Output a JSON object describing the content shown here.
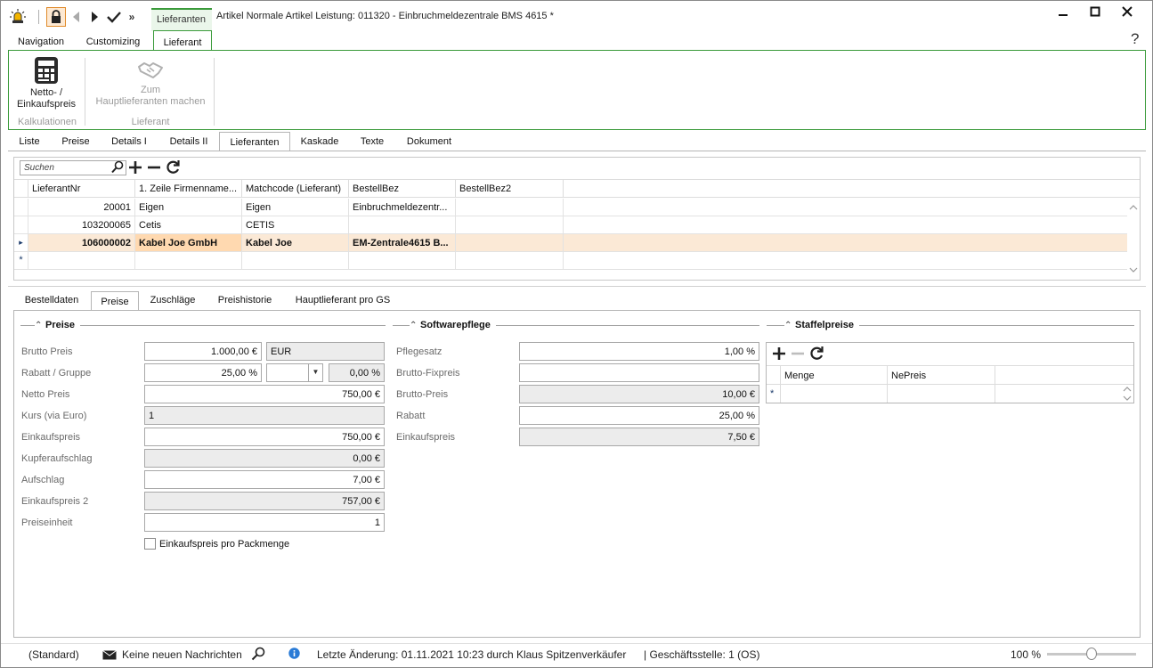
{
  "window": {
    "title": "Artikel Normale Artikel Leistung: 011320 - Einbruchmeldezentrale BMS 4615 *",
    "context_tab": "Lieferanten"
  },
  "ribbon_tabs": [
    "Navigation",
    "Customizing",
    "Lieferant"
  ],
  "ribbon": {
    "netto_label_1": "Netto- /",
    "netto_label_2": "Einkaufspreis",
    "group_kalk": "Kalkulationen",
    "zum_label_1": "Zum",
    "zum_label_2": "Hauptlieferanten machen",
    "group_lief": "Lieferant"
  },
  "doc_tabs": [
    "Liste",
    "Preise",
    "Details I",
    "Details II",
    "Lieferanten",
    "Kaskade",
    "Texte",
    "Dokument"
  ],
  "grid": {
    "search_placeholder": "Suchen",
    "columns": [
      "LieferantNr",
      "1. Zeile Firmenname...",
      "Matchcode (Lieferant)",
      "BestellBez",
      "BestellBez2"
    ],
    "rows": [
      {
        "nr": "20001",
        "name": "Eigen",
        "match": "Eigen",
        "bez": "Einbruchmeldezentr...",
        "bez2": ""
      },
      {
        "nr": "103200065",
        "name": "Cetis",
        "match": "CETIS",
        "bez": "",
        "bez2": ""
      },
      {
        "nr": "106000002",
        "name": "Kabel Joe GmbH",
        "match": "Kabel Joe",
        "bez": "EM-Zentrale4615 B...",
        "bez2": ""
      }
    ],
    "new_row_marker": "*",
    "current_row_marker": "▸"
  },
  "detail_tabs": [
    "Bestelldaten",
    "Preise",
    "Zuschläge",
    "Preishistorie",
    "Hauptlieferant pro GS"
  ],
  "preise": {
    "title": "Preise",
    "brutto_label": "Brutto Preis",
    "brutto": "1.000,00 €",
    "currency": "EUR",
    "rabatt_label": "Rabatt / Gruppe",
    "rabatt": "25,00 %",
    "gruppe": "",
    "gruppe_pct": "0,00 %",
    "netto_label": "Netto Preis",
    "netto": "750,00 €",
    "kurs_label": "Kurs (via Euro)",
    "kurs": "1",
    "ek_label": "Einkaufspreis",
    "ek": "750,00 €",
    "kupfer_label": "Kupferaufschlag",
    "kupfer": "0,00 €",
    "aufschlag_label": "Aufschlag",
    "aufschlag": "7,00 €",
    "ek2_label": "Einkaufspreis 2",
    "ek2": "757,00 €",
    "einheit_label": "Preiseinheit",
    "einheit": "1",
    "checkbox_label": "Einkaufspreis pro Packmenge"
  },
  "software": {
    "title": "Softwarepflege",
    "pflegesatz_label": "Pflegesatz",
    "pflegesatz": "1,00 %",
    "fixpreis_label": "Brutto-Fixpreis",
    "fixpreis": "",
    "brutto_label": "Brutto-Preis",
    "brutto": "10,00 €",
    "rabatt_label": "Rabatt",
    "rabatt": "25,00 %",
    "ek_label": "Einkaufspreis",
    "ek": "7,50 €"
  },
  "staffel": {
    "title": "Staffelpreise",
    "columns": [
      "Menge",
      "NePreis"
    ],
    "new_row_marker": "*"
  },
  "status": {
    "standard": "(Standard)",
    "messages": "Keine neuen Nachrichten",
    "last_change": "Letzte Änderung: 01.11.2021 10:23 durch Klaus Spitzenverkäufer",
    "branch": "| Geschäftsstelle:  1 (OS)",
    "zoom": "100 %"
  }
}
